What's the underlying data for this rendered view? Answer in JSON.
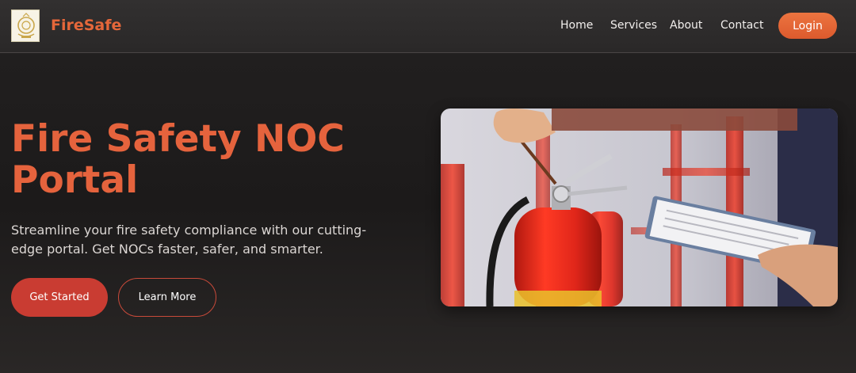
{
  "header": {
    "brand": "FireSafe",
    "logo_icon": "emblem-icon",
    "nav": [
      {
        "label": "Home"
      },
      {
        "label": "Services"
      },
      {
        "label": "About"
      },
      {
        "label": "Contact"
      }
    ],
    "login_label": "Login"
  },
  "hero": {
    "title_line1": "Fire Safety NOC",
    "title_line2": "Portal",
    "subtitle": "Streamline your fire safety compliance with our cutting-edge portal. Get NOCs faster, safer, and smarter.",
    "primary_button": "Get Started",
    "secondary_button": "Learn More",
    "image_subject": "fire-extinguisher-inspection-photo"
  },
  "colors": {
    "accent": "#e5633d",
    "primary_button": "#c93c32",
    "login_button": "#e5673a",
    "background": "#1f1d1d"
  }
}
